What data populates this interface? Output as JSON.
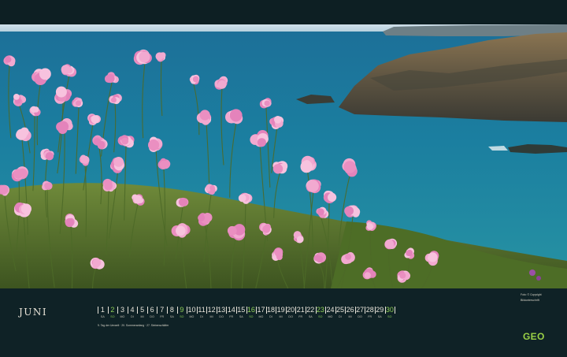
{
  "month": "JUNI",
  "calendar": {
    "days": [
      {
        "n": "1",
        "wd": "SA",
        "sunday": false
      },
      {
        "n": "2",
        "wd": "SO",
        "sunday": true
      },
      {
        "n": "3",
        "wd": "MO",
        "sunday": false
      },
      {
        "n": "4",
        "wd": "DI",
        "sunday": false
      },
      {
        "n": "5",
        "wd": "MI",
        "sunday": false
      },
      {
        "n": "6",
        "wd": "DO",
        "sunday": false
      },
      {
        "n": "7",
        "wd": "FR",
        "sunday": false
      },
      {
        "n": "8",
        "wd": "SA",
        "sunday": false
      },
      {
        "n": "9",
        "wd": "SO",
        "sunday": true
      },
      {
        "n": "10",
        "wd": "MO",
        "sunday": false
      },
      {
        "n": "11",
        "wd": "DI",
        "sunday": false
      },
      {
        "n": "12",
        "wd": "MI",
        "sunday": false
      },
      {
        "n": "13",
        "wd": "DO",
        "sunday": false
      },
      {
        "n": "14",
        "wd": "FR",
        "sunday": false
      },
      {
        "n": "15",
        "wd": "SA",
        "sunday": false
      },
      {
        "n": "16",
        "wd": "SO",
        "sunday": true
      },
      {
        "n": "17",
        "wd": "MO",
        "sunday": false
      },
      {
        "n": "18",
        "wd": "DI",
        "sunday": false
      },
      {
        "n": "19",
        "wd": "MI",
        "sunday": false
      },
      {
        "n": "20",
        "wd": "DO",
        "sunday": false
      },
      {
        "n": "21",
        "wd": "FR",
        "sunday": false
      },
      {
        "n": "22",
        "wd": "SA",
        "sunday": false
      },
      {
        "n": "23",
        "wd": "SO",
        "sunday": true
      },
      {
        "n": "24",
        "wd": "MO",
        "sunday": false
      },
      {
        "n": "25",
        "wd": "DI",
        "sunday": false
      },
      {
        "n": "26",
        "wd": "MI",
        "sunday": false
      },
      {
        "n": "27",
        "wd": "DO",
        "sunday": false
      },
      {
        "n": "28",
        "wd": "FR",
        "sunday": false
      },
      {
        "n": "29",
        "wd": "SA",
        "sunday": false
      },
      {
        "n": "30",
        "wd": "SO",
        "sunday": true
      }
    ],
    "holidays_note": "9. Tag der Umwelt · 20. Sommeranfang · 27. Siebenschläfer"
  },
  "credit": {
    "line": "Foto: © Copyright",
    "agency": "Bildunterschrift"
  },
  "logo_text": "GEO",
  "colors": {
    "band": "#0f2226",
    "text": "#e7e3d9",
    "sunday": "#8fcf57",
    "logo": "#9ad146"
  }
}
